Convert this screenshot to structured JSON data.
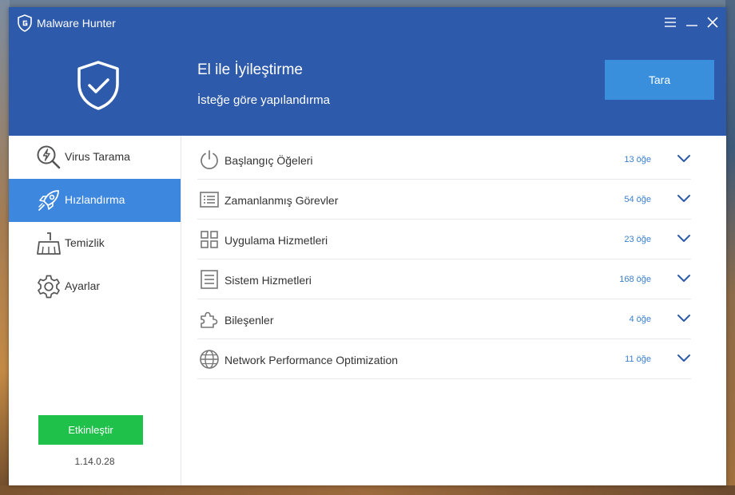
{
  "app": {
    "title": "Malware Hunter",
    "version": "1.14.0.28"
  },
  "header": {
    "title": "El ile İyileştirme",
    "subtitle": "İsteğe göre yapılandırma",
    "scan_label": "Tara"
  },
  "sidebar": {
    "items": [
      {
        "label": "Virus Tarama",
        "icon": "virus-scan-icon",
        "active": false
      },
      {
        "label": "Hızlandırma",
        "icon": "rocket-icon",
        "active": true
      },
      {
        "label": "Temizlik",
        "icon": "broom-icon",
        "active": false
      },
      {
        "label": "Ayarlar",
        "icon": "gear-icon",
        "active": false
      }
    ],
    "activate_label": "Etkinleştir"
  },
  "items": [
    {
      "label": "Başlangıç Öğeleri",
      "count": "13 öğe",
      "icon": "power-icon"
    },
    {
      "label": "Zamanlanmış Görevler",
      "count": "54 öğe",
      "icon": "list-icon"
    },
    {
      "label": "Uygulama Hizmetleri",
      "count": "23 öğe",
      "icon": "grid-icon"
    },
    {
      "label": "Sistem Hizmetleri",
      "count": "168 öğe",
      "icon": "document-icon"
    },
    {
      "label": "Bileşenler",
      "count": "4 öğe",
      "icon": "puzzle-icon"
    },
    {
      "label": "Network Performance Optimization",
      "count": "11 öğe",
      "icon": "globe-icon"
    }
  ],
  "colors": {
    "header": "#2d5aaa",
    "accent": "#3d87de",
    "scan_button": "#3a8fdc",
    "activate_button": "#1fc14a",
    "count_text": "#3b7fcf"
  }
}
